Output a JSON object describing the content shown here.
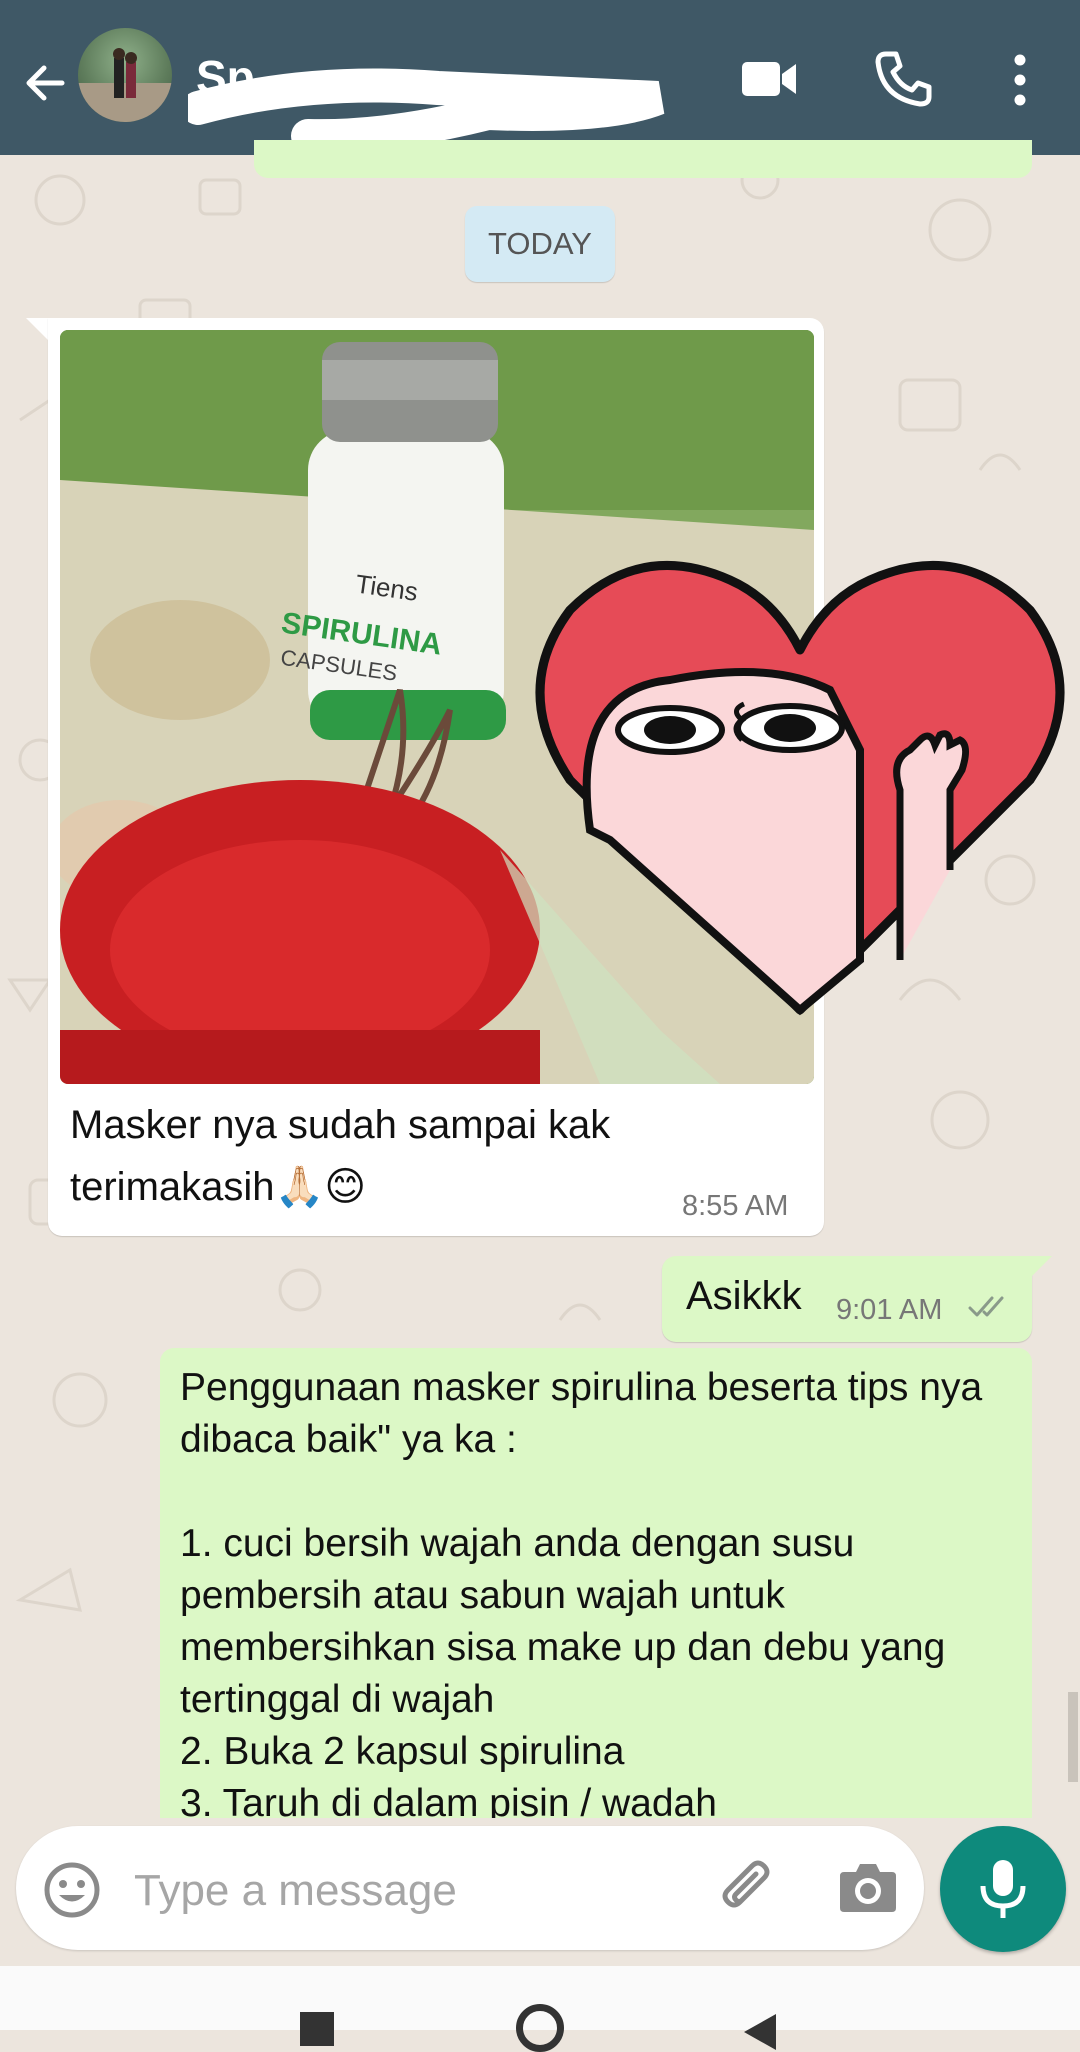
{
  "header": {
    "contact_name": "Sp",
    "colors": {
      "bar": "#3f5866",
      "icons": "#ffffff"
    },
    "icons": [
      "back-arrow-icon",
      "video-call-icon",
      "phone-call-icon",
      "more-vert-icon"
    ]
  },
  "chat": {
    "date_chip": "TODAY",
    "incoming_message": {
      "caption_line1": "Masker nya sudah sampai kak",
      "caption_line2": "terimakasih🙏🏻😊",
      "time": "8:55 AM",
      "photo_text": {
        "brand": "Tiens",
        "product": "SPIRULINA",
        "subtitle": "CAPSULES"
      }
    },
    "outgoing_short": {
      "text": "Asikkk",
      "time": "9:01 AM",
      "status": "double-check"
    },
    "outgoing_long": {
      "text": "Penggunaan masker spirulina beserta tips nya dibaca baik\" ya ka :\n\n1. cuci bersih wajah anda dengan susu pembersih atau sabun wajah untuk membersihkan sisa make up dan debu yang tertinggal di wajah\n2. Buka 2 kapsul spirulina\n3. Taruh di dalam pisin / wadah"
    },
    "colors": {
      "incoming_bubble": "#ffffff",
      "outgoing_bubble": "#dcf8c6",
      "wallpaper": "#ece5dd",
      "date_chip": "#d4eaf4"
    }
  },
  "composer": {
    "placeholder": "Type a message",
    "icons": [
      "emoji-icon",
      "attach-icon",
      "camera-icon",
      "mic-icon"
    ],
    "mic_color": "#0e8a7c"
  }
}
